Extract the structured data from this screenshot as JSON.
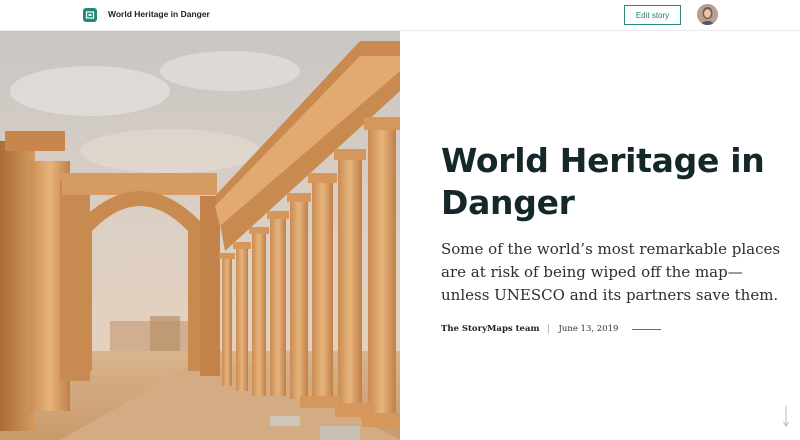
{
  "header": {
    "story_title": "World Heritage in Danger",
    "edit_button_label": "Edit story",
    "logo_icon": "storymaps-logo-icon",
    "avatar_icon": "user-avatar"
  },
  "hero": {
    "image_subject": "ancient-colonnade-ruins",
    "title": "World Heritage in Danger",
    "subtitle": "Some of the world’s most remarkable places are at risk of being wiped off the map—unless UNESCO and its partners save them.",
    "author": "The StoryMaps team",
    "date": "June 13, 2019"
  },
  "colors": {
    "accent": "#2a8a7c",
    "title": "#14282a",
    "sand": "#d9a66b",
    "sky": "#d8cfc8"
  }
}
